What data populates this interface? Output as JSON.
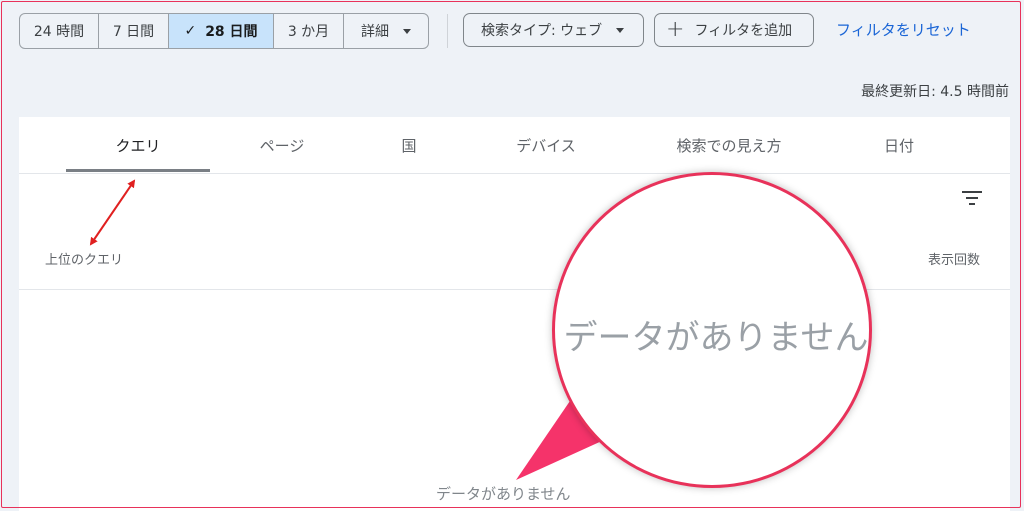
{
  "toolbar": {
    "ranges": [
      {
        "label": "24 時間"
      },
      {
        "label": "7 日間"
      },
      {
        "label": "28 日間"
      },
      {
        "label": "3 か月"
      },
      {
        "label": "詳細"
      }
    ],
    "selected_range": "28 日間",
    "search_type": "検索タイプ: ウェブ",
    "add_filter": "フィルタを追加",
    "reset_filters": "フィルタをリセット"
  },
  "last_updated": "最終更新日: 4.5 時間前",
  "tabs": [
    {
      "label": "クエリ"
    },
    {
      "label": "ページ"
    },
    {
      "label": "国"
    },
    {
      "label": "デバイス"
    },
    {
      "label": "検索での見え方"
    },
    {
      "label": "日付"
    }
  ],
  "active_tab": "クエリ",
  "table": {
    "column_left": "上位のクエリ",
    "column_right": "表示回数",
    "empty_message": "データがありません"
  },
  "annotation": {
    "magnified_text": "データがありません"
  },
  "colors": {
    "accent_selected": "#c8e3fb",
    "link": "#1a65d6",
    "annotation": "#e8325a",
    "arrow": "#e02020"
  },
  "icons": {
    "check": "check-icon",
    "dropdown": "caret-down-icon",
    "add": "plus-icon",
    "filter": "filter-icon"
  }
}
